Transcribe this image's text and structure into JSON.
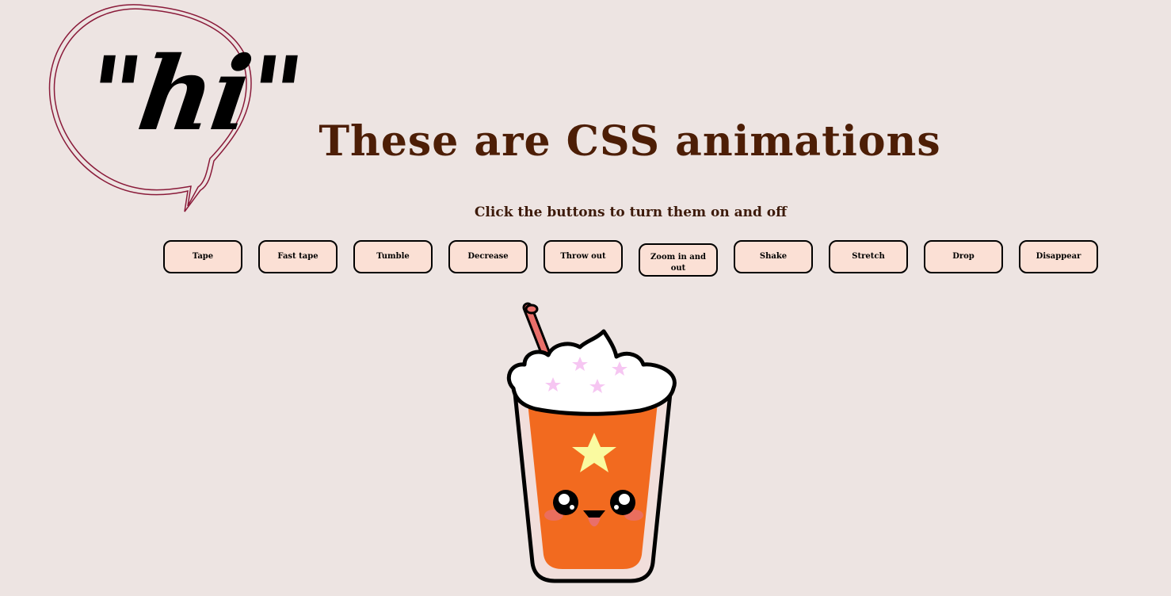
{
  "logo": {
    "text": "\"hi\""
  },
  "header": {
    "title": "These are CSS animations",
    "subtitle": "Click the buttons to turn them on and off"
  },
  "buttons": [
    {
      "label": "Tape"
    },
    {
      "label": "Fast tape"
    },
    {
      "label": "Tumble"
    },
    {
      "label": "Decrease"
    },
    {
      "label": "Throw out"
    },
    {
      "label": "Zoom in and out"
    },
    {
      "label": "Shake"
    },
    {
      "label": "Stretch"
    },
    {
      "label": "Drop"
    },
    {
      "label": "Disappear"
    }
  ],
  "colors": {
    "background": "#ede4e2",
    "title": "#4d1e06",
    "button_fill": "#fbe0d5",
    "cup_drink": "#f26a1f",
    "bubble_stroke": "#8a1b3a"
  },
  "icons": {
    "logo": "speech-bubble-icon",
    "illustration": "kawaii-drink-cup-icon"
  }
}
